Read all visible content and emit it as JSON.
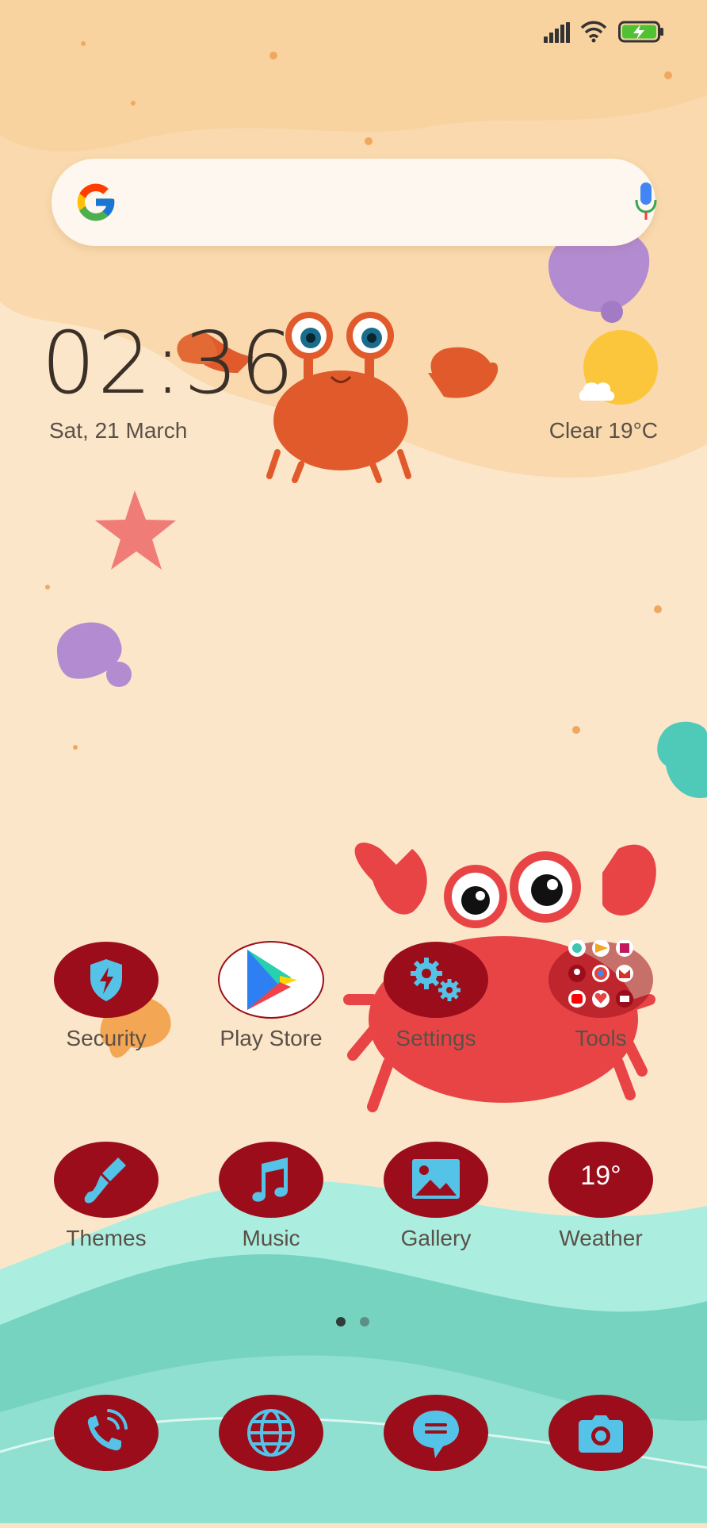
{
  "status_bar": {
    "signal_icon": "cellular-signal-icon",
    "wifi_icon": "wifi-icon",
    "battery_icon": "battery-charging-icon"
  },
  "search_widget": {
    "logo_icon": "google-g-icon",
    "mic_icon": "microphone-icon"
  },
  "clock_widget": {
    "time": "02:36",
    "date": "Sat, 21 March",
    "weather": "Clear  19°C",
    "weather_icon": "partly-sunny-icon"
  },
  "home_row_1": [
    {
      "label": "Security",
      "icon": "shield-lightning-icon"
    },
    {
      "label": "Play Store",
      "icon": "play-store-icon"
    },
    {
      "label": "Settings",
      "icon": "gears-icon"
    },
    {
      "label": "Tools",
      "icon": "folder-icon"
    }
  ],
  "home_row_2": [
    {
      "label": "Themes",
      "icon": "paintbrush-icon"
    },
    {
      "label": "Music",
      "icon": "music-note-icon"
    },
    {
      "label": "Gallery",
      "icon": "image-icon"
    },
    {
      "label": "Weather",
      "icon": "weather-icon",
      "value": "19°"
    }
  ],
  "page_indicator": {
    "pages": 2,
    "current": 1
  },
  "dock": [
    {
      "icon": "phone-icon"
    },
    {
      "icon": "globe-icon"
    },
    {
      "icon": "message-icon"
    },
    {
      "icon": "camera-icon"
    }
  ],
  "colors": {
    "icon_bg": "#9b0d1a",
    "icon_glyph": "#55c3e8",
    "sand": "#fbe3c4",
    "sea": "#7ed8c8"
  }
}
